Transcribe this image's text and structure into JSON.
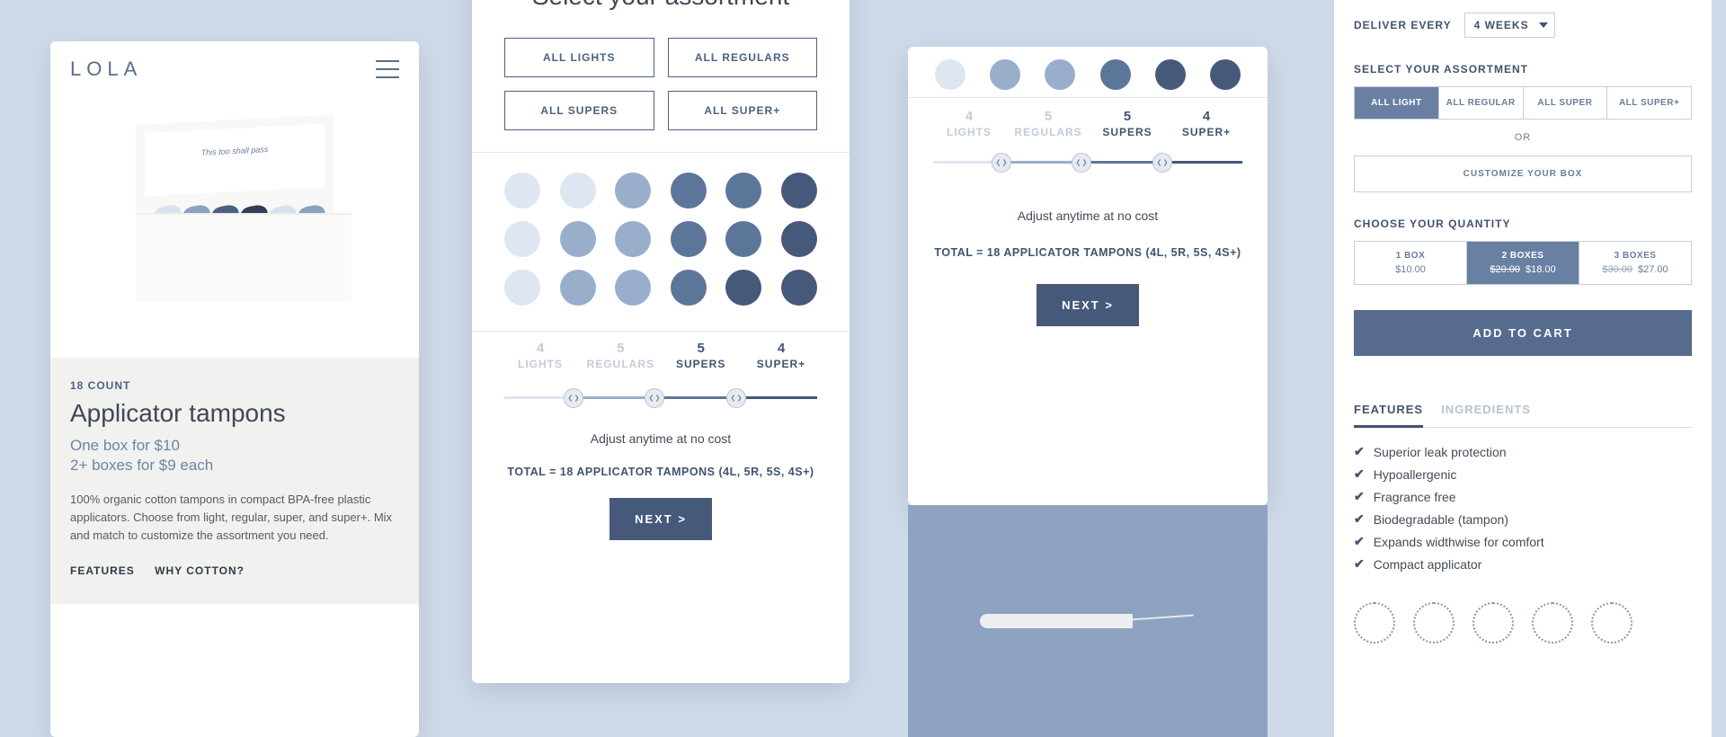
{
  "brand": "LOLA",
  "panel1": {
    "box_motto": "This too shall pass",
    "count_label": "18 COUNT",
    "title": "Applicator tampons",
    "price_a": "One box for $10",
    "price_b": "2+ boxes for $9 each",
    "description": "100% organic cotton tampons in compact BPA-free plastic applicators. Choose from light, regular, super, and super+. Mix and match to customize the assortment you need.",
    "link_features": "FEATURES",
    "link_why": "WHY COTTON?"
  },
  "panel2": {
    "title": "Select your assortment",
    "presets": [
      "ALL LIGHTS",
      "ALL REGULARS",
      "ALL SUPERS",
      "ALL SUPER+"
    ],
    "labels": [
      {
        "num": "4",
        "lbl": "LIGHTS",
        "active": false
      },
      {
        "num": "5",
        "lbl": "REGULARS",
        "active": false
      },
      {
        "num": "5",
        "lbl": "SUPERS",
        "active": true
      },
      {
        "num": "4",
        "lbl": "SUPER+",
        "active": true
      }
    ],
    "adjust_note": "Adjust anytime at no cost",
    "total_line": "TOTAL = 18 APPLICATOR TAMPONS (4L, 5R, 5S, 4S+)",
    "next": "NEXT >"
  },
  "panel3": {
    "labels": [
      {
        "num": "4",
        "lbl": "LIGHTS",
        "active": false
      },
      {
        "num": "5",
        "lbl": "REGULARS",
        "active": false
      },
      {
        "num": "5",
        "lbl": "SUPERS",
        "active": true
      },
      {
        "num": "4",
        "lbl": "SUPER+",
        "active": true
      }
    ],
    "adjust_note": "Adjust anytime at no cost",
    "total_line": "TOTAL = 18 APPLICATOR TAMPONS (4L, 5R, 5S, 4S+)",
    "next": "NEXT >"
  },
  "panel4": {
    "deliver_label": "DELIVER EVERY",
    "deliver_value": "4 WEEKS",
    "select_assort_label": "SELECT YOUR ASSORTMENT",
    "chips": [
      "ALL LIGHT",
      "ALL REGULAR",
      "ALL SUPER",
      "ALL SUPER+"
    ],
    "chip_selected_index": 0,
    "or": "OR",
    "customize": "CUSTOMIZE YOUR BOX",
    "qty_label": "CHOOSE YOUR QUANTITY",
    "qty_options": [
      {
        "lab": "1 BOX",
        "strike": "",
        "price": "$10.00",
        "selected": false
      },
      {
        "lab": "2 BOXES",
        "strike": "$20.00",
        "price": "$18.00",
        "selected": true
      },
      {
        "lab": "3 BOXES",
        "strike": "$30.00",
        "price": "$27.00",
        "selected": false
      }
    ],
    "add_to_cart": "ADD TO CART",
    "tab_features": "FEATURES",
    "tab_ingredients": "INGREDIENTS",
    "features": [
      "Superior leak protection",
      "Hypoallergenic",
      "Fragrance free",
      "Biodegradable (tampon)",
      "Expands widthwise for comfort",
      "Compact applicator"
    ]
  }
}
